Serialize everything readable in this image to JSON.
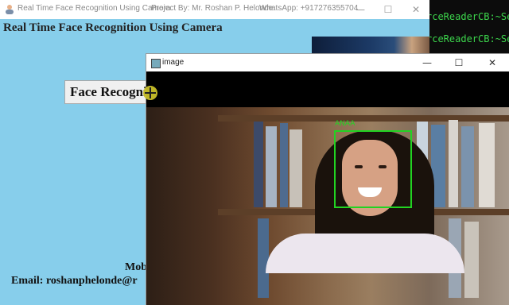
{
  "terminal": {
    "lines": [
      "rceReaderCB:~Se",
      "rceReaderCB:~Se"
    ]
  },
  "main_window": {
    "title_parts": [
      "Real Time Face Recognition Using Camera",
      "Project By: Mr. Roshan P. Helonde",
      "WhatsApp: +917276355704"
    ],
    "controls": {
      "minimize": "—",
      "maximize": "☐",
      "close": "✕"
    },
    "heading": "Real Time Face Recognition Using Camera",
    "face_button_label": "Face Recognition",
    "mobile_text": "Mob",
    "email_text": "Email: roshanphelonde@r",
    "background_color": "#87ceeb"
  },
  "image_window": {
    "title": "image",
    "controls": {
      "minimize": "—",
      "maximize": "☐",
      "close": "✕"
    },
    "detection": {
      "label": "ANAA",
      "color": "#22d322"
    }
  },
  "icons": [
    "app-icon",
    "image-window-icon",
    "cursor-move-icon"
  ]
}
